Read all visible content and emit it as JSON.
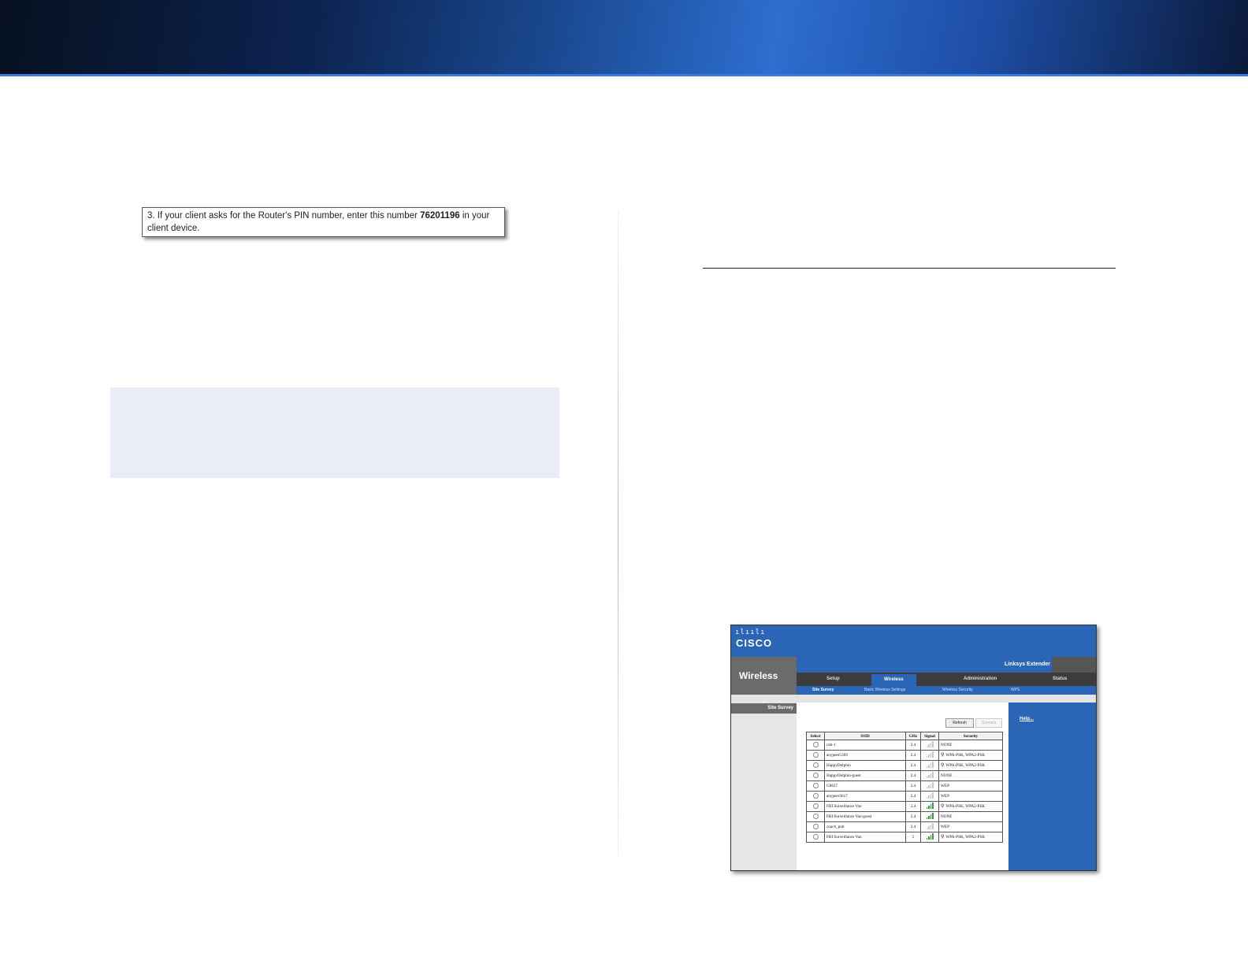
{
  "pin_instruction": {
    "line1_prefix": "3. If your client asks for the Router's PIN number, enter this number ",
    "pin": "76201196",
    "line1_suffix": " in your",
    "line2": "client device."
  },
  "screenshot": {
    "brand_bars": "ılıılı",
    "brand": "CISCO",
    "section_title": "Wireless",
    "product_name": "Linksys Extender",
    "tabs": [
      {
        "label": "Setup"
      },
      {
        "label": "Wireless"
      },
      {
        "label": "Administration"
      },
      {
        "label": "Status"
      }
    ],
    "subtabs": [
      {
        "label": "Site Survey"
      },
      {
        "label": "Basic Wireless Settings"
      },
      {
        "label": "Wireless Security"
      },
      {
        "label": "WPS"
      }
    ],
    "side_label": "Site Survey",
    "help_label": "Help...",
    "refresh_label": "Refresh",
    "connect_label": "Connect",
    "table": {
      "headers": [
        "Select",
        "SSID",
        "GHz",
        "Signal",
        "Security"
      ],
      "rows": [
        {
          "ssid": "cab-1",
          "ghz": "2.4",
          "signal": "low",
          "lock": false,
          "security": "NONE"
        },
        {
          "ssid": "anypeer5369",
          "ghz": "2.4",
          "signal": "low",
          "lock": true,
          "security": "WPA-PSK, WPA2-PSK"
        },
        {
          "ssid": "HappyDolphin",
          "ghz": "2.4",
          "signal": "low",
          "lock": true,
          "security": "WPA-PSK, WPA2-PSK"
        },
        {
          "ssid": "HappyDolphin-guest",
          "ghz": "2.4",
          "signal": "low",
          "lock": false,
          "security": "NONE"
        },
        {
          "ssid": "G8637",
          "ghz": "2.4",
          "signal": "low",
          "lock": false,
          "security": "WEP"
        },
        {
          "ssid": "anypeer3617",
          "ghz": "2.4",
          "signal": "low",
          "lock": false,
          "security": "WEP"
        },
        {
          "ssid": "FBI Surveillance Van",
          "ghz": "2.4",
          "signal": "high",
          "lock": true,
          "security": "WPA-PSK, WPA2-PSK"
        },
        {
          "ssid": "FBI Surveillance Van-guest",
          "ghz": "2.4",
          "signal": "high",
          "lock": false,
          "security": "NONE"
        },
        {
          "ssid": "coach_pub",
          "ghz": "2.4",
          "signal": "low",
          "lock": false,
          "security": "WEP"
        },
        {
          "ssid": "FBI Surveillance Van",
          "ghz": "5",
          "signal": "high",
          "lock": true,
          "security": "WPA-PSK, WPA2-PSK"
        }
      ]
    }
  },
  "colors": {
    "banner_blue": "#2d6ecf",
    "cisco_blue": "#2b65b5",
    "note_bg": "#e8edf8",
    "signal_green": "#3a9a3a"
  }
}
